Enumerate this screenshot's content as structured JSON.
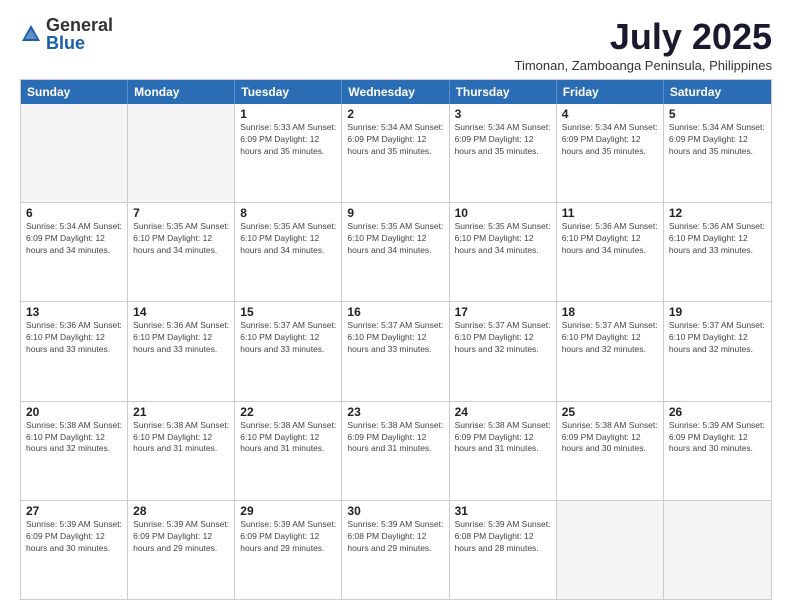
{
  "logo": {
    "general": "General",
    "blue": "Blue"
  },
  "title": "July 2025",
  "subtitle": "Timonan, Zamboanga Peninsula, Philippines",
  "header_days": [
    "Sunday",
    "Monday",
    "Tuesday",
    "Wednesday",
    "Thursday",
    "Friday",
    "Saturday"
  ],
  "weeks": [
    [
      {
        "day": "",
        "info": ""
      },
      {
        "day": "",
        "info": ""
      },
      {
        "day": "1",
        "info": "Sunrise: 5:33 AM\nSunset: 6:09 PM\nDaylight: 12 hours and 35 minutes."
      },
      {
        "day": "2",
        "info": "Sunrise: 5:34 AM\nSunset: 6:09 PM\nDaylight: 12 hours and 35 minutes."
      },
      {
        "day": "3",
        "info": "Sunrise: 5:34 AM\nSunset: 6:09 PM\nDaylight: 12 hours and 35 minutes."
      },
      {
        "day": "4",
        "info": "Sunrise: 5:34 AM\nSunset: 6:09 PM\nDaylight: 12 hours and 35 minutes."
      },
      {
        "day": "5",
        "info": "Sunrise: 5:34 AM\nSunset: 6:09 PM\nDaylight: 12 hours and 35 minutes."
      }
    ],
    [
      {
        "day": "6",
        "info": "Sunrise: 5:34 AM\nSunset: 6:09 PM\nDaylight: 12 hours and 34 minutes."
      },
      {
        "day": "7",
        "info": "Sunrise: 5:35 AM\nSunset: 6:10 PM\nDaylight: 12 hours and 34 minutes."
      },
      {
        "day": "8",
        "info": "Sunrise: 5:35 AM\nSunset: 6:10 PM\nDaylight: 12 hours and 34 minutes."
      },
      {
        "day": "9",
        "info": "Sunrise: 5:35 AM\nSunset: 6:10 PM\nDaylight: 12 hours and 34 minutes."
      },
      {
        "day": "10",
        "info": "Sunrise: 5:35 AM\nSunset: 6:10 PM\nDaylight: 12 hours and 34 minutes."
      },
      {
        "day": "11",
        "info": "Sunrise: 5:36 AM\nSunset: 6:10 PM\nDaylight: 12 hours and 34 minutes."
      },
      {
        "day": "12",
        "info": "Sunrise: 5:36 AM\nSunset: 6:10 PM\nDaylight: 12 hours and 33 minutes."
      }
    ],
    [
      {
        "day": "13",
        "info": "Sunrise: 5:36 AM\nSunset: 6:10 PM\nDaylight: 12 hours and 33 minutes."
      },
      {
        "day": "14",
        "info": "Sunrise: 5:36 AM\nSunset: 6:10 PM\nDaylight: 12 hours and 33 minutes."
      },
      {
        "day": "15",
        "info": "Sunrise: 5:37 AM\nSunset: 6:10 PM\nDaylight: 12 hours and 33 minutes."
      },
      {
        "day": "16",
        "info": "Sunrise: 5:37 AM\nSunset: 6:10 PM\nDaylight: 12 hours and 33 minutes."
      },
      {
        "day": "17",
        "info": "Sunrise: 5:37 AM\nSunset: 6:10 PM\nDaylight: 12 hours and 32 minutes."
      },
      {
        "day": "18",
        "info": "Sunrise: 5:37 AM\nSunset: 6:10 PM\nDaylight: 12 hours and 32 minutes."
      },
      {
        "day": "19",
        "info": "Sunrise: 5:37 AM\nSunset: 6:10 PM\nDaylight: 12 hours and 32 minutes."
      }
    ],
    [
      {
        "day": "20",
        "info": "Sunrise: 5:38 AM\nSunset: 6:10 PM\nDaylight: 12 hours and 32 minutes."
      },
      {
        "day": "21",
        "info": "Sunrise: 5:38 AM\nSunset: 6:10 PM\nDaylight: 12 hours and 31 minutes."
      },
      {
        "day": "22",
        "info": "Sunrise: 5:38 AM\nSunset: 6:10 PM\nDaylight: 12 hours and 31 minutes."
      },
      {
        "day": "23",
        "info": "Sunrise: 5:38 AM\nSunset: 6:09 PM\nDaylight: 12 hours and 31 minutes."
      },
      {
        "day": "24",
        "info": "Sunrise: 5:38 AM\nSunset: 6:09 PM\nDaylight: 12 hours and 31 minutes."
      },
      {
        "day": "25",
        "info": "Sunrise: 5:38 AM\nSunset: 6:09 PM\nDaylight: 12 hours and 30 minutes."
      },
      {
        "day": "26",
        "info": "Sunrise: 5:39 AM\nSunset: 6:09 PM\nDaylight: 12 hours and 30 minutes."
      }
    ],
    [
      {
        "day": "27",
        "info": "Sunrise: 5:39 AM\nSunset: 6:09 PM\nDaylight: 12 hours and 30 minutes."
      },
      {
        "day": "28",
        "info": "Sunrise: 5:39 AM\nSunset: 6:09 PM\nDaylight: 12 hours and 29 minutes."
      },
      {
        "day": "29",
        "info": "Sunrise: 5:39 AM\nSunset: 6:09 PM\nDaylight: 12 hours and 29 minutes."
      },
      {
        "day": "30",
        "info": "Sunrise: 5:39 AM\nSunset: 6:08 PM\nDaylight: 12 hours and 29 minutes."
      },
      {
        "day": "31",
        "info": "Sunrise: 5:39 AM\nSunset: 6:08 PM\nDaylight: 12 hours and 28 minutes."
      },
      {
        "day": "",
        "info": ""
      },
      {
        "day": "",
        "info": ""
      }
    ]
  ]
}
